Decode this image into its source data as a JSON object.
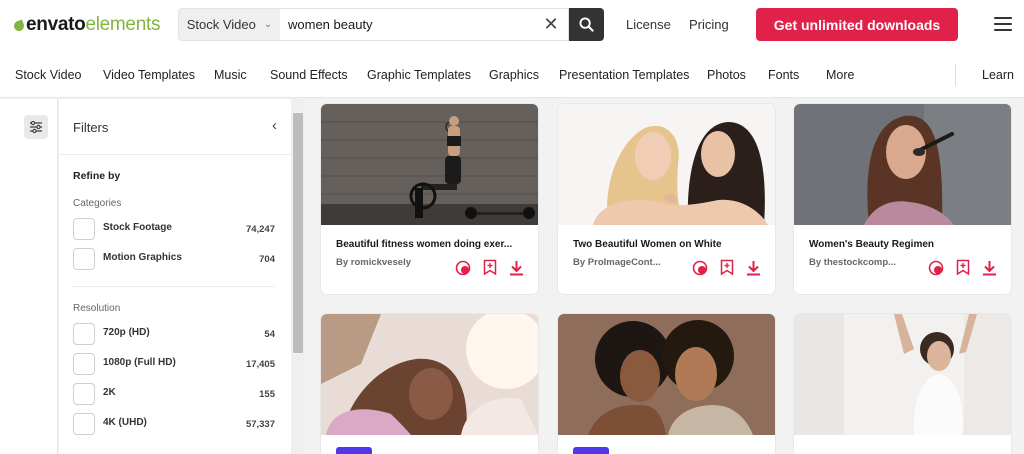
{
  "header": {
    "logo_part1": "envato",
    "logo_part2": "elements",
    "search_type": "Stock Video",
    "search_value": "women beauty",
    "links": [
      "License",
      "Pricing"
    ],
    "cta": "Get unlimited downloads"
  },
  "nav": {
    "items": [
      "Stock Video",
      "Video Templates",
      "Music",
      "Sound Effects",
      "Graphic Templates",
      "Graphics",
      "Presentation Templates",
      "Photos",
      "Fonts",
      "More"
    ],
    "learn": "Learn"
  },
  "filters": {
    "title": "Filters",
    "refine": "Refine by",
    "categories_label": "Categories",
    "categories": [
      {
        "label": "Stock Footage",
        "count": "74,247"
      },
      {
        "label": "Motion Graphics",
        "count": "704"
      }
    ],
    "resolution_label": "Resolution",
    "resolutions": [
      {
        "label": "720p (HD)",
        "count": "54"
      },
      {
        "label": "1080p (Full HD)",
        "count": "17,405"
      },
      {
        "label": "2K",
        "count": "155"
      },
      {
        "label": "4K (UHD)",
        "count": "57,337"
      }
    ]
  },
  "cards": [
    {
      "title": "Beautiful fitness women doing exer...",
      "author": "By romickvesely"
    },
    {
      "title": "Two Beautiful Women on White",
      "author": "By ProImageCont..."
    },
    {
      "title": "Women's Beauty Regimen",
      "author": "By thestockcomp..."
    }
  ],
  "colors": {
    "accent": "#e0214a",
    "brand_green": "#82b541",
    "new_badge": "#4d39e8"
  }
}
